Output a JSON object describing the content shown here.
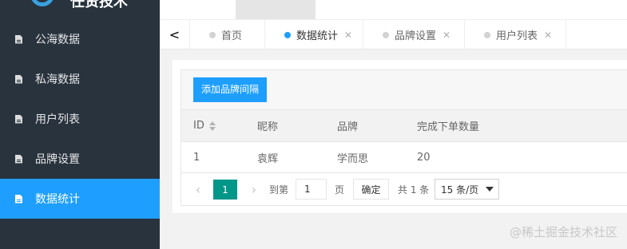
{
  "sidebar": {
    "logo_text": "任贤技术",
    "items": [
      {
        "label": "公海数据",
        "icon": "file-icon",
        "active": false
      },
      {
        "label": "私海数据",
        "icon": "file-icon",
        "active": false
      },
      {
        "label": "用户列表",
        "icon": "file-icon",
        "active": false
      },
      {
        "label": "品牌设置",
        "icon": "file-icon",
        "active": false
      },
      {
        "label": "数据统计",
        "icon": "file-icon",
        "active": true
      }
    ]
  },
  "tabs": {
    "prev_glyph": "<",
    "items": [
      {
        "label": "首页",
        "active": false,
        "closable": false
      },
      {
        "label": "数据统计",
        "active": true,
        "closable": true
      },
      {
        "label": "品牌设置",
        "active": false,
        "closable": true
      },
      {
        "label": "用户列表",
        "active": false,
        "closable": true
      }
    ],
    "close_glyph": "✕"
  },
  "toolbar": {
    "add_label": "添加品牌间隔"
  },
  "table": {
    "columns": [
      "ID",
      "昵称",
      "品牌",
      "完成下单数量"
    ],
    "rows": [
      [
        "1",
        "袁辉",
        "学而思",
        "20"
      ]
    ]
  },
  "pager": {
    "prev_glyph": "‹",
    "next_glyph": "›",
    "current": "1",
    "goto_label": "到第",
    "goto_value": "1",
    "page_unit": "页",
    "confirm_label": "确定",
    "total_text": "共 1 条",
    "limit_value": "15 条/页"
  },
  "watermark": "@稀土掘金技术社区",
  "colors": {
    "sidebar_bg": "#28333e",
    "accent": "#1e9fff",
    "page_current": "#009688"
  }
}
